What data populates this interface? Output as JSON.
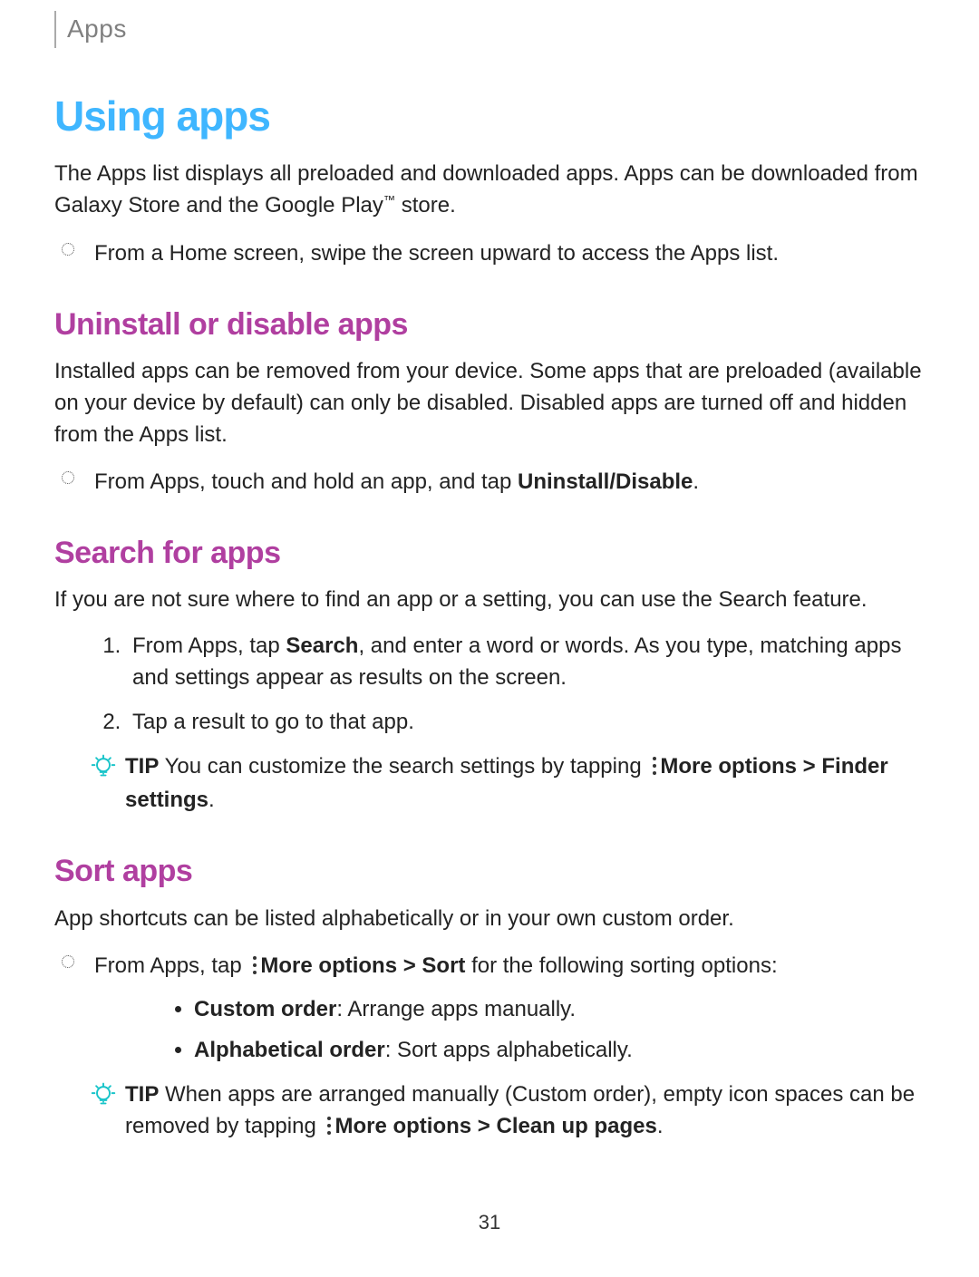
{
  "header": {
    "section": "Apps"
  },
  "h1": "Using apps",
  "intro": {
    "pre": "The Apps list displays all preloaded and downloaded apps. Apps can be downloaded from Galaxy Store and the Google Play",
    "tm": "™",
    "post": " store."
  },
  "intro_bullet": "From a Home screen, swipe the screen upward to access the Apps list.",
  "uninstall": {
    "heading": "Uninstall or disable apps",
    "para": "Installed apps can be removed from your device. Some apps that are preloaded (available on your device by default) can only be disabled. Disabled apps are turned off and hidden from the Apps list.",
    "bullet_pre": "From Apps, touch and hold an app, and tap ",
    "bullet_bold": "Uninstall/Disable",
    "bullet_post": "."
  },
  "search": {
    "heading": "Search for apps",
    "para": "If you are not sure where to find an app or a setting, you can use the Search feature.",
    "step1_pre": "From Apps, tap ",
    "step1_bold": "Search",
    "step1_post": ", and enter a word or words. As you type, matching apps and settings appear as results on the screen.",
    "step2": "Tap a result to go to that app.",
    "tip_label": "TIP",
    "tip_pre": "  You can customize the search settings by tapping ",
    "tip_more": "More options",
    "tip_chev": " > ",
    "tip_finder": "Finder settings",
    "tip_end": "."
  },
  "sort": {
    "heading": "Sort apps",
    "para": "App shortcuts can be listed alphabetically or in your own custom order.",
    "bullet_pre": "From Apps, tap ",
    "bullet_more": "More options",
    "bullet_chev": " > ",
    "bullet_sort": "Sort",
    "bullet_post": " for the following sorting options:",
    "sub1_bold": "Custom order",
    "sub1_post": ": Arrange apps manually.",
    "sub2_bold": "Alphabetical order",
    "sub2_post": ": Sort apps alphabetically.",
    "tip_label": "TIP",
    "tip_pre": "  When apps are arranged manually (Custom order), empty icon spaces can be removed by tapping ",
    "tip_more": "More options",
    "tip_chev": " > ",
    "tip_clean": "Clean up pages",
    "tip_end": "."
  },
  "pagenum": "31"
}
